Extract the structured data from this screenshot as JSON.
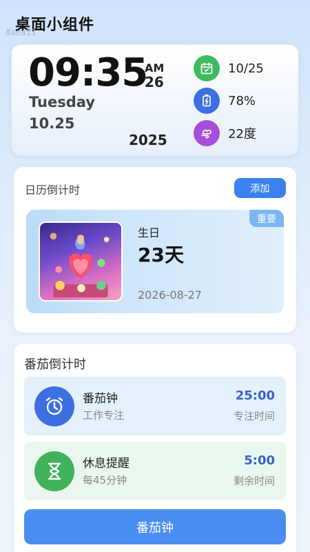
{
  "app": {
    "title": "桌面小组件",
    "watermark": "8aea11"
  },
  "clock": {
    "time": "09:35",
    "ampm": "AM",
    "seconds": "26",
    "weekday": "Tuesday",
    "date": "10.25",
    "year": "2025"
  },
  "stats": [
    {
      "icon": "calendar-check-icon",
      "value": "10/25",
      "color": "#3fba5e"
    },
    {
      "icon": "battery-charging-icon",
      "value": "78%",
      "color": "#3d6fe0"
    },
    {
      "icon": "weather-wind-icon",
      "value": "22度",
      "color": "#a64fd9"
    }
  ],
  "calendar": {
    "title": "日历倒计时",
    "add_label": "添加",
    "event": {
      "tag": "重要",
      "name": "生日",
      "days": "23天",
      "date": "2026-08-27"
    }
  },
  "pomodoro": {
    "title": "番茄倒计时",
    "items": [
      {
        "name": "番茄钟",
        "desc": "工作专注",
        "value": "25:00",
        "label": "专注时间",
        "icon": "alarm-clock-icon"
      },
      {
        "name": "休息提醒",
        "desc": "每45分钟",
        "value": "5:00",
        "label": "剩余时间",
        "icon": "hourglass-icon"
      }
    ],
    "button_label": "番茄钟"
  }
}
